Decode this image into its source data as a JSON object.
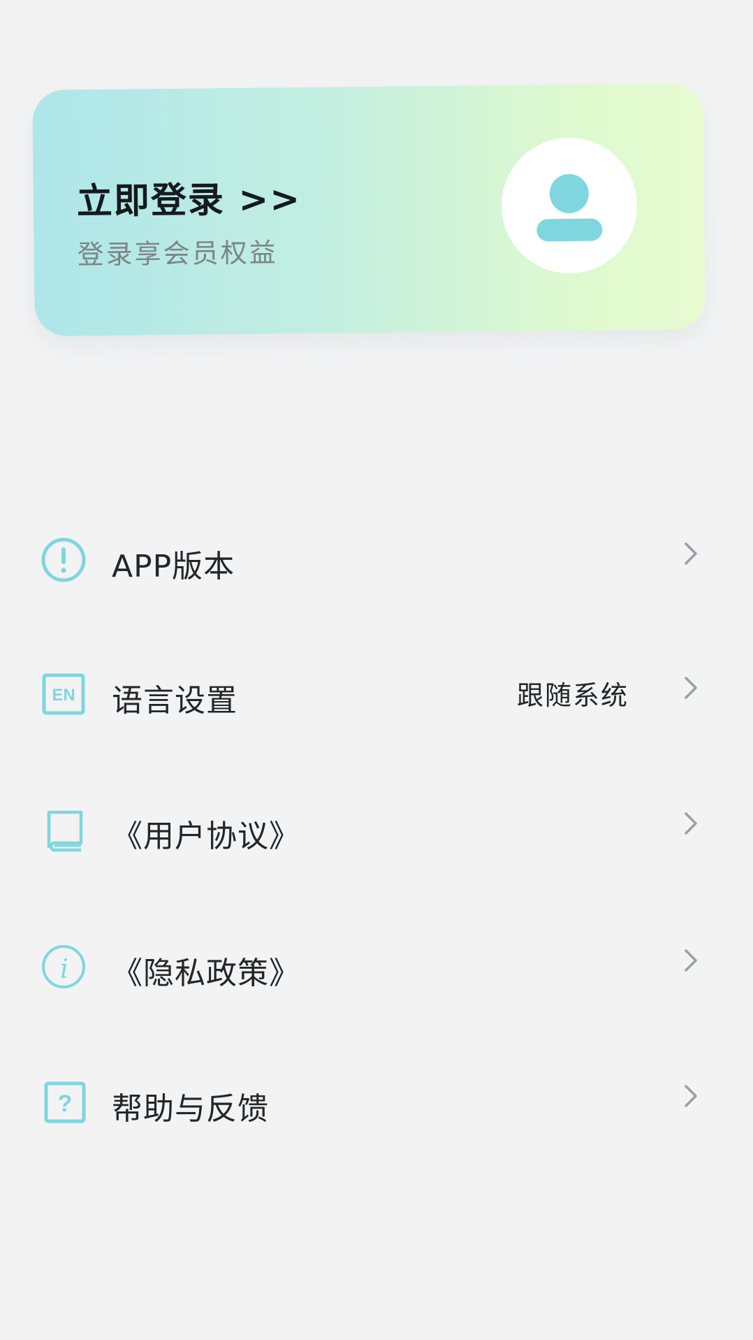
{
  "login_card": {
    "title": "立即登录 >>",
    "subtitle": "登录享会员权益",
    "avatar_icon": "user-avatar-icon",
    "gradient_colors": [
      "#aee6ea",
      "#def9cf"
    ]
  },
  "accent_color": "#7fd6df",
  "menu": {
    "items": [
      {
        "id": "app-version",
        "label": "APP版本",
        "value": "",
        "icon": "exclamation-circle-icon"
      },
      {
        "id": "language",
        "label": "语言设置",
        "value": "跟随系统",
        "icon": "en-language-icon"
      },
      {
        "id": "user-agreement",
        "label": "《用户协议》",
        "value": "",
        "icon": "book-icon"
      },
      {
        "id": "privacy-policy",
        "label": "《隐私政策》",
        "value": "",
        "icon": "info-circle-icon"
      },
      {
        "id": "help-feedback",
        "label": "帮助与反馈",
        "value": "",
        "icon": "question-square-icon"
      }
    ]
  }
}
